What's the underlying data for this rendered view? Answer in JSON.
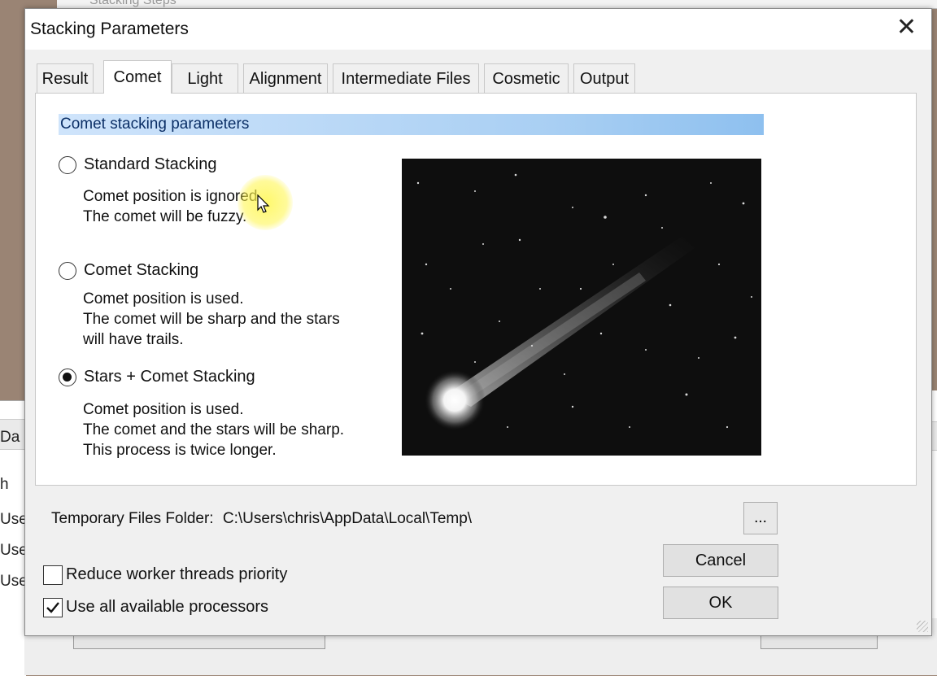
{
  "background": {
    "top_window_title": "Stacking Steps",
    "left_window_texts": [
      "Da",
      "h",
      "Use",
      "Use",
      "Use"
    ]
  },
  "dialog": {
    "title": "Stacking Parameters",
    "close_icon": "close-icon"
  },
  "tabs": [
    {
      "label": "Result"
    },
    {
      "label": "Comet"
    },
    {
      "label": "Light"
    },
    {
      "label": "Alignment"
    },
    {
      "label": "Intermediate Files"
    },
    {
      "label": "Cosmetic"
    },
    {
      "label": "Output"
    }
  ],
  "active_tab": "Comet",
  "comet": {
    "header": "Comet stacking parameters",
    "options": [
      {
        "label": "Standard Stacking",
        "checked": false,
        "desc": [
          "Comet position is ignored.",
          "The comet will be fuzzy."
        ]
      },
      {
        "label": "Comet Stacking",
        "checked": false,
        "desc": [
          "Comet position is used.",
          "The comet will be sharp and the stars",
          "will have trails."
        ]
      },
      {
        "label": "Stars + Comet Stacking",
        "checked": true,
        "desc": [
          "Comet position is used.",
          "The comet and the stars will be sharp.",
          "This process is twice longer."
        ]
      }
    ]
  },
  "footer": {
    "temp_folder_label": "Temporary Files Folder:",
    "temp_folder_path": "C:\\Users\\chris\\AppData\\Local\\Temp\\",
    "browse_label": "...",
    "reduce_priority_label": "Reduce worker threads priority",
    "reduce_priority_checked": false,
    "use_all_processors_label": "Use all available processors",
    "use_all_processors_checked": true,
    "cancel_label": "Cancel",
    "ok_label": "OK"
  },
  "colors": {
    "header_text": "#0b2f66",
    "header_gradient_end": "#8ec0ef",
    "cursor_highlight": "#fff550"
  }
}
